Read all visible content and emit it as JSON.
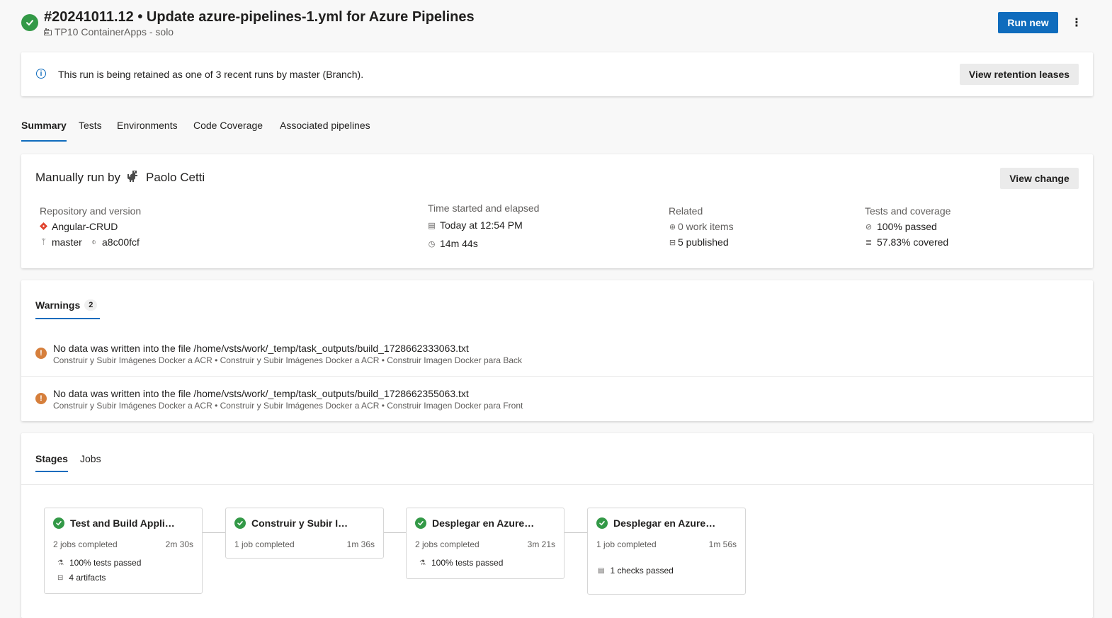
{
  "header": {
    "title": "#20241011.12 • Update azure-pipelines-1.yml for Azure Pipelines",
    "subtitle": "TP10 ContainerApps - solo",
    "run_new_label": "Run new",
    "more_label": "⋮"
  },
  "retention": {
    "message": "This run is being retained as one of 3 recent runs by master (Branch).",
    "button_label": "View retention leases"
  },
  "tabs": [
    {
      "label": "Summary",
      "active": true
    },
    {
      "label": "Tests"
    },
    {
      "label": "Environments"
    },
    {
      "label": "Code Coverage"
    },
    {
      "label": "Associated pipelines"
    }
  ],
  "summary": {
    "run_by_prefix": "Manually run by",
    "user_name": "Paolo Cetti",
    "view_change_label": "View change",
    "repo_label": "Repository and version",
    "repo_name": "Angular-CRUD",
    "branch": "master",
    "commit": "a8c00fcf",
    "time_label": "Time started and elapsed",
    "started": "Today at 12:54 PM",
    "elapsed": "14m 44s",
    "related_label": "Related",
    "work_items": "0 work items",
    "published": "5 published",
    "tests_label": "Tests and coverage",
    "tests_passed": "100% passed",
    "coverage": "57.83% covered"
  },
  "warnings": {
    "tab_label": "Warnings",
    "count": "2",
    "items": [
      {
        "title": "No data was written into the file /home/vsts/work/_temp/task_outputs/build_1728662333063.txt",
        "path": "Construir y Subir Imágenes Docker a ACR • Construir y Subir Imágenes Docker a ACR • Construir Imagen Docker para Back"
      },
      {
        "title": "No data was written into the file /home/vsts/work/_temp/task_outputs/build_1728662355063.txt",
        "path": "Construir y Subir Imágenes Docker a ACR • Construir y Subir Imágenes Docker a ACR • Construir Imagen Docker para Front"
      }
    ]
  },
  "stages": {
    "tabs": [
      {
        "label": "Stages",
        "active": true
      },
      {
        "label": "Jobs"
      }
    ],
    "items": [
      {
        "name": "Test and Build Appli…",
        "jobs": "2 jobs completed",
        "duration": "2m 30s",
        "lines": [
          "100% tests passed",
          "4 artifacts"
        ]
      },
      {
        "name": "Construir y Subir I…",
        "jobs": "1 job completed",
        "duration": "1m 36s",
        "lines": []
      },
      {
        "name": "Desplegar en Azure…",
        "jobs": "2 jobs completed",
        "duration": "3m 21s",
        "lines": [
          "100% tests passed"
        ]
      },
      {
        "name": "Desplegar en Azure…",
        "jobs": "1 job completed",
        "duration": "1m 56s",
        "lines": [
          "1 checks passed"
        ]
      }
    ]
  },
  "colors": {
    "accent": "#0f6cbd",
    "success": "#339947",
    "warning": "#d67f3c",
    "repo_icon": "#e0432e"
  }
}
